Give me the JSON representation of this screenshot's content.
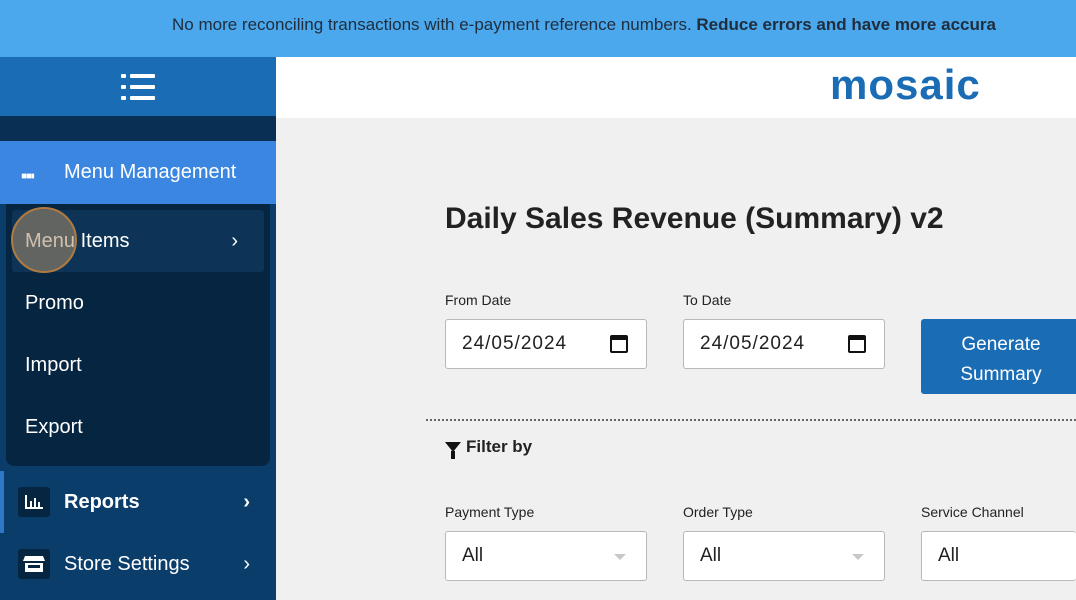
{
  "banner": {
    "text": "No more reconciling transactions with e-payment reference numbers. ",
    "bold": "Reduce errors and have more accura"
  },
  "sidebar": {
    "section": {
      "label": "Menu Management",
      "icon": "utensils-icon"
    },
    "submenu": [
      {
        "label": "Menu Items",
        "active": true
      },
      {
        "label": "Promo"
      },
      {
        "label": "Import"
      },
      {
        "label": "Export"
      }
    ],
    "nav": [
      {
        "label": "Reports",
        "icon": "bar-chart-icon"
      },
      {
        "label": "Store Settings",
        "icon": "store-icon"
      }
    ]
  },
  "header": {
    "logo": "mosaic"
  },
  "main": {
    "title": "Daily Sales Revenue (Summary) v2",
    "from_label": "From Date",
    "from_value": "24/05/2024",
    "to_label": "To Date",
    "to_value": "24/05/2024",
    "generate_line1": "Generate",
    "generate_line2": "Summary",
    "filter_label": "Filter by",
    "filters": [
      {
        "label": "Payment Type",
        "value": "All"
      },
      {
        "label": "Order Type",
        "value": "All"
      },
      {
        "label": "Service Channel",
        "value": "All"
      }
    ]
  },
  "colors": {
    "accent": "#1a6db5",
    "banner": "#4ba8ec",
    "sidebar": "#0b3d6b",
    "active_section": "#3a86e0"
  }
}
